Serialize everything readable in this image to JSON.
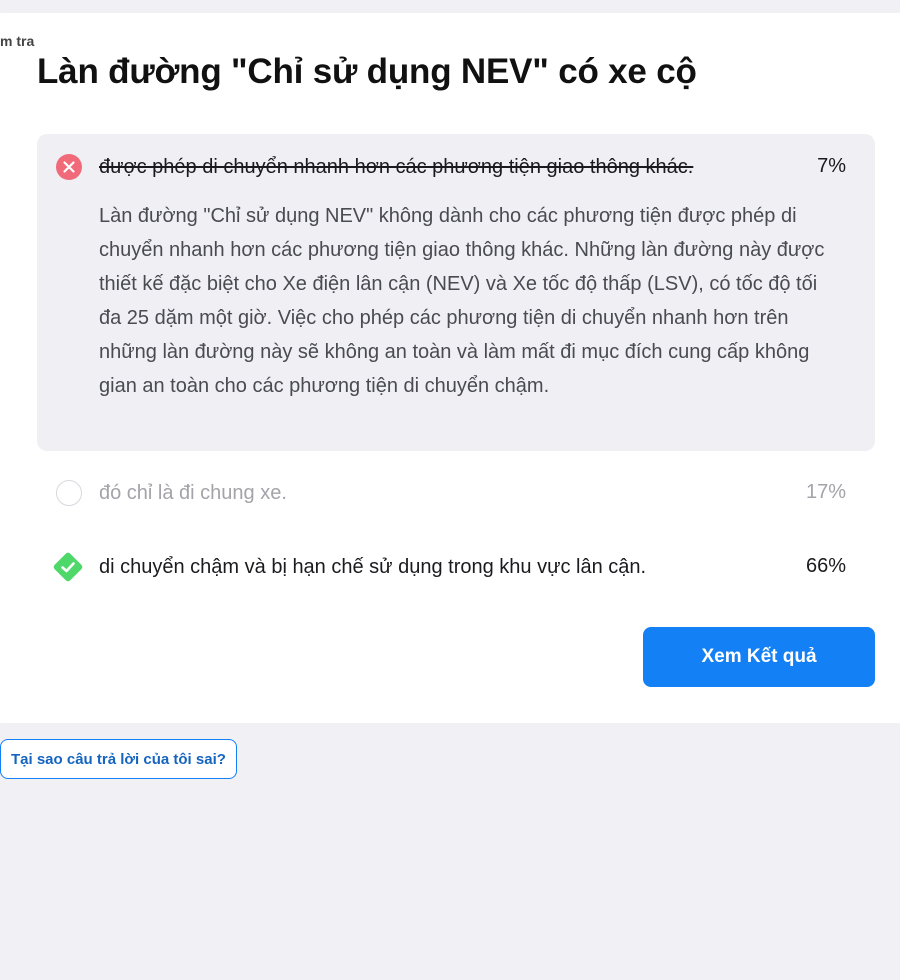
{
  "breadcrumb": "m tra",
  "question": {
    "title": "Làn đường \"Chỉ sử dụng NEV\" có xe cộ"
  },
  "options": [
    {
      "text": "được phép di chuyển nhanh hơn các phương tiện giao thông khác.",
      "percent": "7%",
      "status": "wrong",
      "explanation": "Làn đường \"Chỉ sử dụng NEV\" không dành cho các phương tiện được phép di chuyển nhanh hơn các phương tiện giao thông khác. Những làn đường này được thiết kế đặc biệt cho Xe điện lân cận (NEV) và Xe tốc độ thấp (LSV), có tốc độ tối đa 25 dặm một giờ. Việc cho phép các phương tiện di chuyển nhanh hơn trên những làn đường này sẽ không an toàn và làm mất đi mục đích cung cấp không gian an toàn cho các phương tiện di chuyển chậm."
    },
    {
      "text": "đó chỉ là đi chung xe.",
      "percent": "17%",
      "status": "neutral"
    },
    {
      "text": "di chuyển chậm và bị hạn chế sử dụng trong khu vực lân cận.",
      "percent": "66%",
      "status": "correct"
    }
  ],
  "actions": {
    "results_label": "Xem Kết quả",
    "why_wrong_label": "Tại sao câu trả lời của tôi sai?"
  },
  "icons": {
    "wrong": "close-icon",
    "neutral": "empty-circle-icon",
    "correct": "check-icon"
  },
  "colors": {
    "background": "#f0f0f5",
    "card": "#ffffff",
    "wrong_red": "#f16a7a",
    "correct_green": "#4fd86a",
    "primary_blue": "#1380f5",
    "explanation_bg": "#efeff4"
  }
}
